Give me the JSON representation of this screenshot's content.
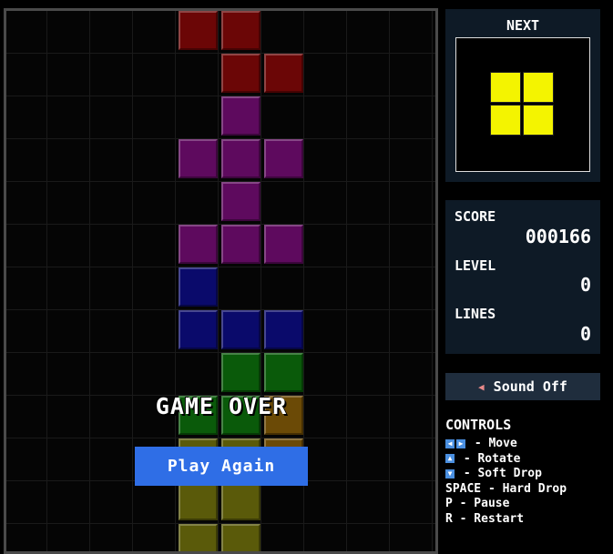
{
  "board": {
    "cells": [
      {
        "col": 4,
        "row": 0,
        "color": "#6b0606"
      },
      {
        "col": 5,
        "row": 0,
        "color": "#6b0606"
      },
      {
        "col": 5,
        "row": 1,
        "color": "#6b0606"
      },
      {
        "col": 6,
        "row": 1,
        "color": "#6b0606"
      },
      {
        "col": 5,
        "row": 2,
        "color": "#5e0a5e"
      },
      {
        "col": 4,
        "row": 3,
        "color": "#5e0a5e"
      },
      {
        "col": 5,
        "row": 3,
        "color": "#5e0a5e"
      },
      {
        "col": 6,
        "row": 3,
        "color": "#5e0a5e"
      },
      {
        "col": 5,
        "row": 4,
        "color": "#5e0a5e"
      },
      {
        "col": 4,
        "row": 5,
        "color": "#5e0a5e"
      },
      {
        "col": 5,
        "row": 5,
        "color": "#5e0a5e"
      },
      {
        "col": 6,
        "row": 5,
        "color": "#5e0a5e"
      },
      {
        "col": 4,
        "row": 6,
        "color": "#0a0a6b"
      },
      {
        "col": 4,
        "row": 7,
        "color": "#0a0a6b"
      },
      {
        "col": 5,
        "row": 7,
        "color": "#0a0a6b"
      },
      {
        "col": 6,
        "row": 7,
        "color": "#0a0a6b"
      },
      {
        "col": 5,
        "row": 8,
        "color": "#0a5a0a"
      },
      {
        "col": 6,
        "row": 8,
        "color": "#0a5a0a"
      },
      {
        "col": 4,
        "row": 9,
        "color": "#0a5a0a"
      },
      {
        "col": 5,
        "row": 9,
        "color": "#0a5a0a"
      },
      {
        "col": 6,
        "row": 9,
        "color": "#6b4a06"
      },
      {
        "col": 4,
        "row": 10,
        "color": "#5a5a0a"
      },
      {
        "col": 5,
        "row": 10,
        "color": "#5a5a0a"
      },
      {
        "col": 6,
        "row": 10,
        "color": "#6b4a06"
      },
      {
        "col": 4,
        "row": 11,
        "color": "#5a5a0a"
      },
      {
        "col": 5,
        "row": 11,
        "color": "#5a5a0a"
      },
      {
        "col": 4,
        "row": 12,
        "color": "#5a5a0a"
      },
      {
        "col": 5,
        "row": 12,
        "color": "#5a5a0a"
      }
    ],
    "game_over_text": "GAME OVER",
    "play_again_label": "Play Again"
  },
  "next": {
    "title": "NEXT",
    "piece_color": "#f4f400",
    "cells": [
      [
        0,
        0
      ],
      [
        1,
        0
      ],
      [
        0,
        1
      ],
      [
        1,
        1
      ]
    ]
  },
  "stats": {
    "score_label": "SCORE",
    "score_value": "000166",
    "level_label": "LEVEL",
    "level_value": "0",
    "lines_label": "LINES",
    "lines_value": "0"
  },
  "sound": {
    "icon": "speaker-muted-icon",
    "label": "Sound Off"
  },
  "controls": {
    "title": "CONTROLS",
    "move": " - Move",
    "rotate": " - Rotate",
    "soft_drop": " - Soft Drop",
    "hard_drop": "SPACE - Hard Drop",
    "pause": "P - Pause",
    "restart": "R - Restart"
  },
  "colors": {
    "accent": "#2f6ee6",
    "panel_bg": "#0e1a26"
  }
}
